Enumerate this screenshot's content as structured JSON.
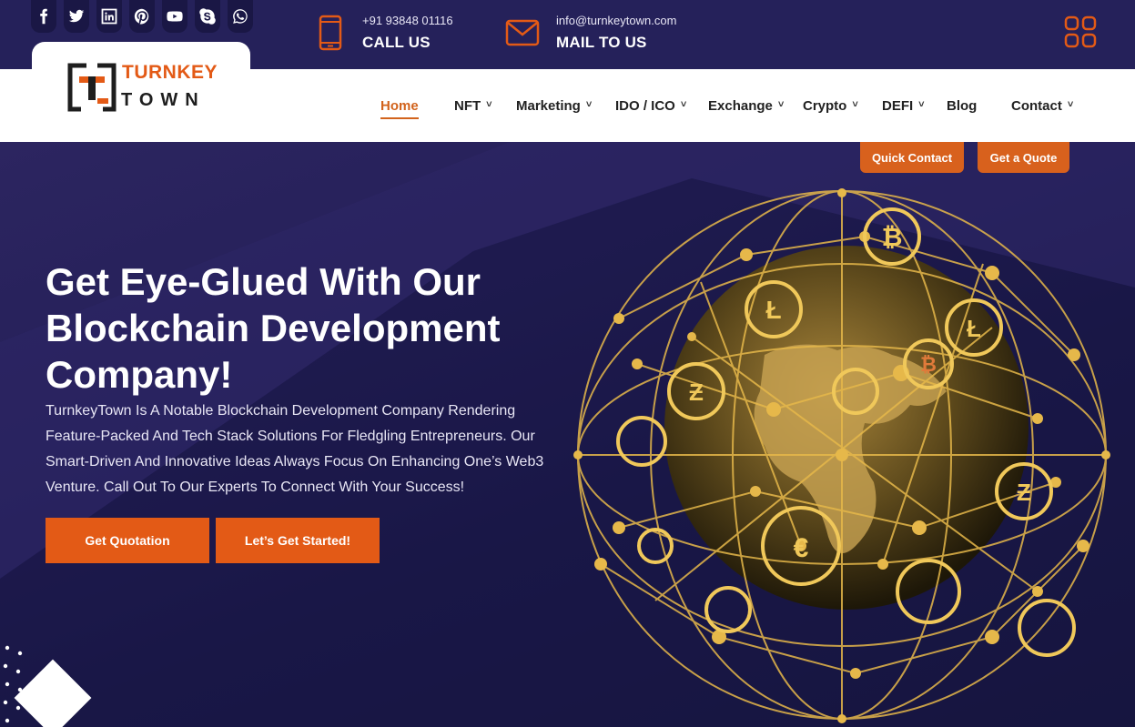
{
  "topbar": {
    "socials": [
      {
        "icon": "facebook-icon"
      },
      {
        "icon": "twitter-icon"
      },
      {
        "icon": "linkedin-icon"
      },
      {
        "icon": "pinterest-icon"
      },
      {
        "icon": "youtube-icon"
      },
      {
        "icon": "skype-icon"
      },
      {
        "icon": "whatsapp-icon"
      }
    ],
    "phone": {
      "number": "+91 93848 01116",
      "label": "CALL US",
      "icon": "phone-icon"
    },
    "mail": {
      "address": "info@turnkeytown.com",
      "label": "MAIL TO US",
      "icon": "mail-icon"
    },
    "menu_icon": "grid-icon"
  },
  "logo": {
    "top": "TURNKEY",
    "bottom": "TOWN"
  },
  "nav": {
    "items": [
      {
        "label": "Home",
        "active": true,
        "dropdown": false
      },
      {
        "label": "NFT",
        "active": false,
        "dropdown": true
      },
      {
        "label": "Marketing",
        "active": false,
        "dropdown": true
      },
      {
        "label": "IDO / ICO",
        "active": false,
        "dropdown": true
      },
      {
        "label": "Exchange",
        "active": false,
        "dropdown": true
      },
      {
        "label": "Crypto",
        "active": false,
        "dropdown": true
      },
      {
        "label": "DEFI",
        "active": false,
        "dropdown": true
      },
      {
        "label": "Blog",
        "active": false,
        "dropdown": false
      },
      {
        "label": "Contact",
        "active": false,
        "dropdown": true
      }
    ],
    "chevron": "˅"
  },
  "hero": {
    "quick_contact": "Quick Contact",
    "get_a_quote": "Get a Quote",
    "title_lines": [
      "Get Eye-Glued With Our",
      "Blockchain Development",
      "Company!"
    ],
    "description": "TurnkeyTown Is A Notable Blockchain Development Company Rendering Feature-Packed And Tech Stack Solutions For Fledgling Entrepreneurs. Our Smart-Driven And Innovative Ideas Always Focus On Enhancing One’s Web3 Venture. Call Out To Our Experts To Connect With Your Success!",
    "cta_primary": "Get Quotation",
    "cta_secondary": "Let’s Get Started!"
  },
  "colors": {
    "brand_orange": "#e35a16",
    "topbar": "#25215a",
    "hero_bg": "#1c1a4c",
    "gold": "#e6b84a"
  }
}
